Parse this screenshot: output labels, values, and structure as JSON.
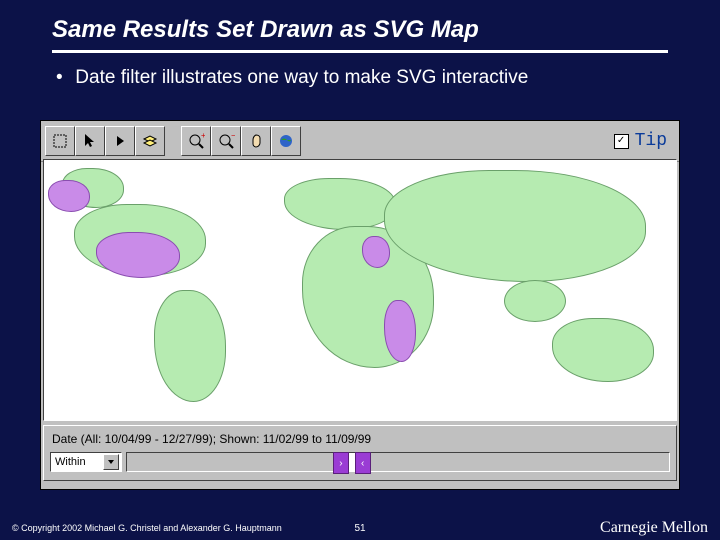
{
  "title": "Same Results Set Drawn as SVG Map",
  "bullet": "Date filter illustrates one way to make SVG interactive",
  "toolbar": {
    "select_box": "select-box",
    "arrow": "pointer",
    "play": "play",
    "layers": "layers",
    "zoom_in": "zoom-in",
    "zoom_out": "zoom-out",
    "pan": "pan",
    "full_extent": "full-extent"
  },
  "tip": {
    "checked": "✓",
    "label": "Tip"
  },
  "date_filter": {
    "label": "Date  (All: 10/04/99 - 12/27/99); Shown: 11/02/99 to 11/09/99",
    "mode": "Within"
  },
  "footer": {
    "copyright": "© Copyright 2002  Michael G. Christel and Alexander G. Hauptmann",
    "page": "51",
    "org": "Carnegie Mellon"
  }
}
